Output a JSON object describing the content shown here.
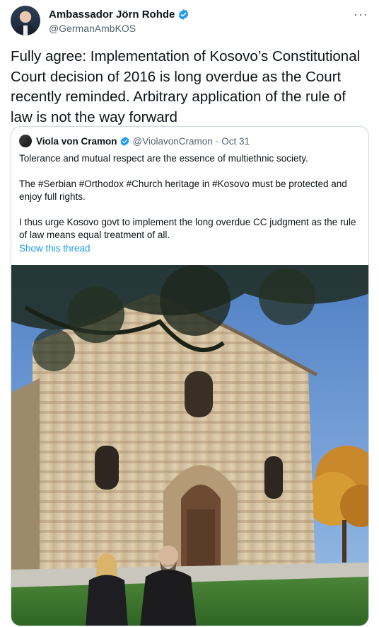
{
  "author": {
    "name": "Ambassador Jörn Rohde",
    "handle": "@GermanAmbKOS",
    "verified_color": "#1d9bf0",
    "avatar_icon": "profile-photo"
  },
  "more_menu_label": "···",
  "tweet": {
    "text": "Fully agree: Implementation of Kosovo’s Constitutional Court decision of 2016 is long overdue as the Court recently reminded. Arbitrary application of the rule of law is not the way forward"
  },
  "quote": {
    "name": "Viola von Cramon",
    "handle": "@ViolavonCramon",
    "separator": "·",
    "date": "Oct 31",
    "paragraphs": [
      "Tolerance and mutual respect are the essence of multiethnic society.",
      "The #Serbian #Orthodox #Church heritage in #Kosovo must be protected and enjoy full rights.",
      "I thus urge Kosovo govt to implement the long overdue CC judgment as the rule of law means equal treatment of all."
    ],
    "show_thread": "Show this thread",
    "link_color": "#1d9bf0"
  }
}
